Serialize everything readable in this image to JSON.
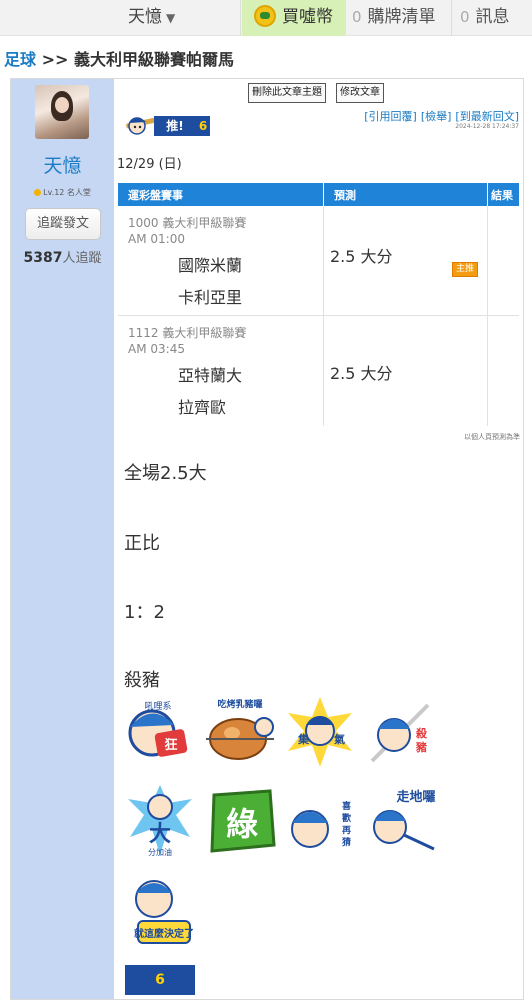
{
  "topnav": {
    "username": "天憶",
    "buy_label": "買噓幣",
    "cart_count": "0",
    "cart_label": "購牌清單",
    "msg_count": "0",
    "msg_label": "訊息"
  },
  "breadcrumb": {
    "link": "足球",
    "sep": " >> ",
    "title": "義大利甲級聯賽帕爾馬"
  },
  "author": {
    "name": "天憶",
    "level": "Lv.12 名人堂",
    "follow_button": "追蹤發文",
    "followers_count": "5387",
    "followers_label": "人追蹤"
  },
  "post": {
    "delete_button": "刪除此文章主題",
    "edit_button": "修改文章",
    "push_label": "推!",
    "push_count": "6",
    "reply_links": [
      "[引用回覆]",
      "[檢舉]",
      "[到最新回文]"
    ],
    "timestamp": "2024-12-28 17:24:37",
    "date": "12/29 (日)",
    "table": {
      "headers": [
        "運彩盤賽事",
        "預測",
        "結果"
      ],
      "rows": [
        {
          "league": "1000 義大利甲級聯賽",
          "time": "AM 01:00",
          "home": "國際米蘭",
          "away": "卡利亞里",
          "prediction": "2.5 大分",
          "tag": "主推"
        },
        {
          "league": "1112 義大利甲級聯賽",
          "time": "AM 03:45",
          "home": "亞特蘭大",
          "away": "拉齊歐",
          "prediction": "2.5 大分",
          "tag": ""
        }
      ]
    },
    "disclaimer": "以個人頁預測為準",
    "lines": [
      "全場2.5大",
      "正比",
      "1：2",
      "殺豬"
    ],
    "stickers": [
      {
        "icon": "baseball-player-sticker",
        "text": "吼哩系 狂"
      },
      {
        "icon": "roast-pig-sticker",
        "text": "吃烤乳豬囉"
      },
      {
        "icon": "focus-sticker",
        "text": "集 氣"
      },
      {
        "icon": "baseball-player-sticker",
        "text": "殺豬"
      },
      {
        "icon": "cheer-sticker",
        "text": "大 分加油"
      },
      {
        "icon": "green-sticker",
        "text": "綠"
      },
      {
        "icon": "baseball-player-sticker",
        "text": "喜歡再猜"
      },
      {
        "icon": "baseball-player-sticker",
        "text": "走地囉"
      },
      {
        "icon": "baseball-player-sticker",
        "text": "就這麼決定了"
      }
    ],
    "bottom_push_count": "6"
  },
  "colors": {
    "sidebar": "#c6d7f4",
    "header_blue": "#1f84d8",
    "badge_blue": "#1e4c9e",
    "buy_green": "#d7f0b6",
    "link_blue": "#1a7cc5"
  }
}
